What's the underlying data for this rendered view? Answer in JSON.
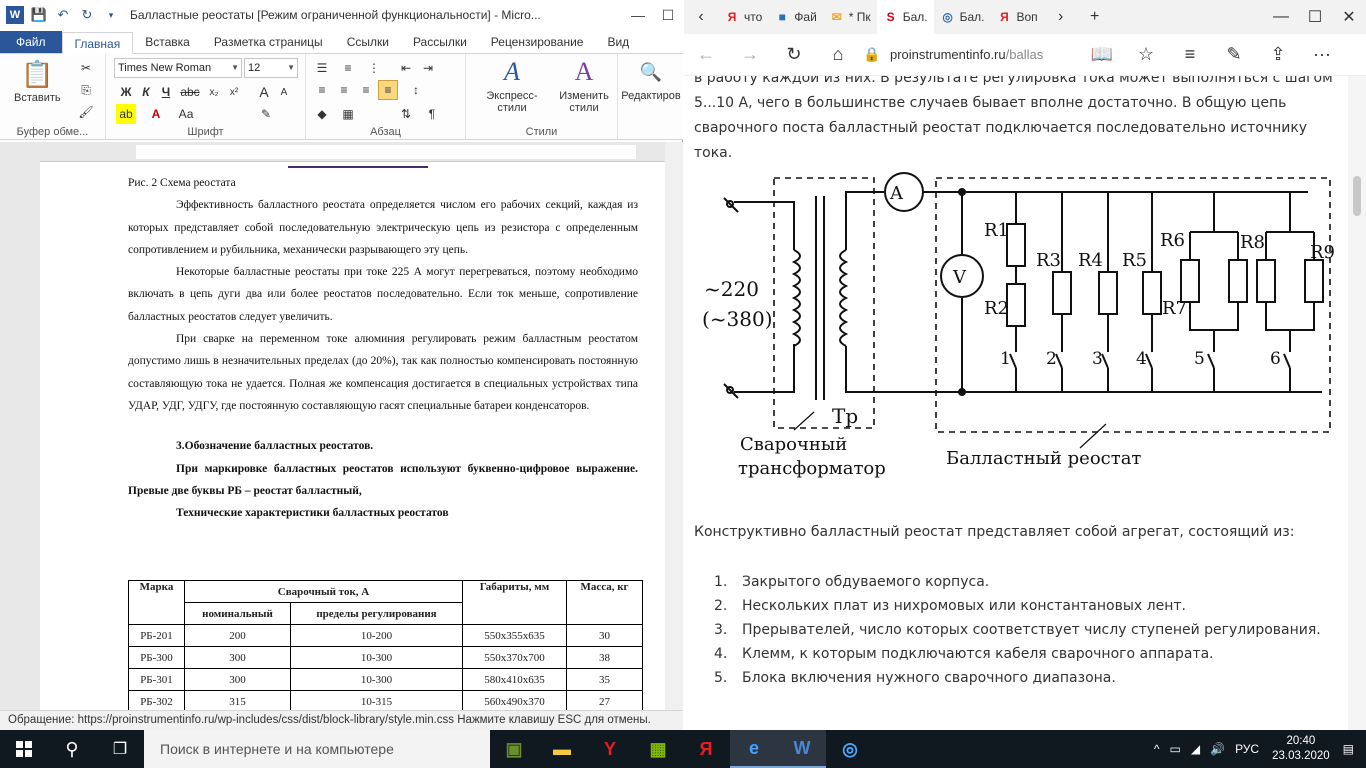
{
  "word": {
    "title": "Балластные реостаты [Режим ограниченной функциональности]  -  Micro...",
    "tabs": [
      "Файл",
      "Главная",
      "Вставка",
      "Разметка страницы",
      "Ссылки",
      "Рассылки",
      "Рецензирование",
      "Вид"
    ],
    "ribbon": {
      "paste": "Вставить",
      "clipboard": "Буфер обме...",
      "font_name": "Times New Roman",
      "font_size": "12",
      "font_group": "Шрифт",
      "para_group": "Абзац",
      "express_styles": "Экспресс-стили",
      "change_styles": "Изменить стили",
      "styles_group": "Стили",
      "editing": "Редактиров"
    },
    "doc": {
      "caption": "Рис. 2 Схема реостата",
      "p1": "Эффективность балластного реостата определяется числом его рабочих секций, каждая из которых представляет собой последовательную электрическую цепь из резистора с определенным сопротивлением и рубильника, механически разрывающего эту цепь.",
      "p2": "Некоторые балластные реостаты при токе 225 А могут перегреваться, поэтому необходимо включать в цепь дуги два или более реостатов последовательно. Если ток меньше, сопротивление балластных реостатов следует увеличить.",
      "p3": "При сварке на переменном токе алюминия регулировать режим балластным реостатом допустимо лишь в незначительных пределах (до 20%), так как полностью компенсировать постоянную составляющую тока не удается. Полная же компенсация достигается в специальных устройствах типа УДАР, УДГ, УДГУ, где постоянную составляющую гасят специальные батареи конденсаторов.",
      "h3": "3.Обозначение балластных реостатов.",
      "p4": "При маркировке балластных реостатов используют буквенно-цифровое выражение. Превые две буквы РБ – реостат балластный,",
      "table_title": "Технические характеристики балластных реостатов",
      "table_head": {
        "mark": "Марка",
        "current": "Сварочный ток, А",
        "nominal": "номинальный",
        "range": "пределы регулирования",
        "dims": "Габариты, мм",
        "mass": "Масса, кг"
      },
      "rows": [
        [
          "РБ-201",
          "200",
          "10-200",
          "550x355x635",
          "30"
        ],
        [
          "РБ-300",
          "300",
          "10-300",
          "550x370x700",
          "38"
        ],
        [
          "РБ-301",
          "300",
          "10-300",
          "580x410x635",
          "35"
        ],
        [
          "РБ-302",
          "315",
          "10-315",
          "560x490x370",
          "27"
        ]
      ]
    },
    "status": "Обращение: https://proinstrumentinfo.ru/wp-includes/css/dist/block-library/style.min.css Нажмите клавишу ESC для отмены."
  },
  "edge": {
    "tabs": [
      {
        "icon": "Я",
        "label": "что",
        "color": "#e31e24"
      },
      {
        "icon": "■",
        "label": "Фай",
        "color": "#2a6ebb"
      },
      {
        "icon": "✉",
        "label": "* Пк",
        "color": "#f5a623"
      },
      {
        "icon": "S",
        "label": "Бал.",
        "color": "#d0021b"
      },
      {
        "icon": "◎",
        "label": "Бал.",
        "color": "#2a6ebb"
      },
      {
        "icon": "Я",
        "label": "Воп",
        "color": "#e31e24"
      }
    ],
    "url_host": "proinstrumentinfo.ru",
    "url_path": "/ballas",
    "para": "в работу каждой из них. В результате регулировка тока может выполняться с шагом 5...10 А, чего в большинстве случаев бывает вполне достаточно. В общую цепь сварочного поста балластный реостат подключается последовательно источнику тока.",
    "diagram": {
      "voltage1": "~220",
      "voltage2": "(~380)",
      "ammeter": "A",
      "voltmeter": "V",
      "tr": "Тр",
      "left_caption1": "Сварочный",
      "left_caption2": "трансформатор",
      "right_caption": "Балластный реостат",
      "resistors": [
        "R1",
        "R2",
        "R3",
        "R4",
        "R5",
        "R6",
        "R7",
        "R8",
        "R9"
      ],
      "switches": [
        "1",
        "2",
        "3",
        "4",
        "5",
        "6"
      ]
    },
    "lead": "Конструктивно балластный реостат представляет собой агрегат, состоящий из:",
    "list": [
      "Закрытого обдуваемого корпуса.",
      "Нескольких плат из нихромовых или константановых лент.",
      "Прерывателей, число которых соответствует числу ступеней регулирования.",
      "Клемм, к которым подключаются кабеля сварочного аппарата.",
      "Блока включения нужного сварочного диапазона."
    ]
  },
  "taskbar": {
    "search_placeholder": "Поиск в интернете и на компьютере",
    "lang": "РУС",
    "time": "20:40",
    "date": "23.03.2020"
  }
}
